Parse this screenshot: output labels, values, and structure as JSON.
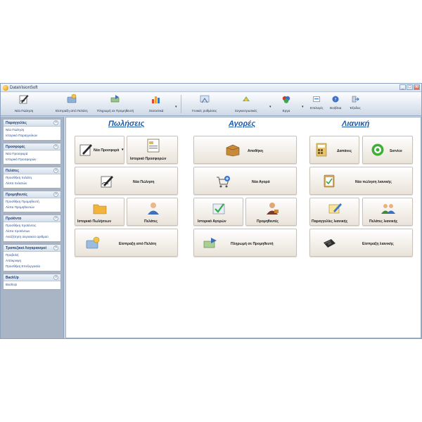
{
  "window": {
    "title": "DataVisionSoft",
    "buttons": [
      "_",
      "□",
      "x"
    ]
  },
  "toolbar": {
    "items": [
      {
        "label": "Νέα Πώληση",
        "icon": "pen-sign-icon"
      },
      {
        "label": "Είσπραξη από Πελάτη",
        "icon": "payment-icon"
      },
      {
        "label": "Πληρωμή σε Προμηθευτή",
        "icon": "money-transfer-icon"
      },
      {
        "label": "Στατιστικά",
        "icon": "statistics-icon"
      },
      {
        "label": "Γενικές ρυθμίσεις",
        "icon": "settings-icon"
      },
      {
        "label": "Συγκεντρωτικές",
        "icon": "summary-icon"
      },
      {
        "label": "Εργα",
        "icon": "projects-icon"
      },
      {
        "label": "Επιλογές",
        "icon": "options-icon"
      },
      {
        "label": "Βοήθεια",
        "icon": "help-icon"
      },
      {
        "label": "Έξοδος",
        "icon": "exit-icon"
      }
    ],
    "dropdown_glyph": "▾"
  },
  "sidebar": {
    "groups": [
      {
        "title": "Παραγγελίες",
        "items": [
          "Νέα Πώληση",
          "Ιστορικό Παραγγελιών"
        ]
      },
      {
        "title": "Προσφορές",
        "items": [
          "Νέα Προσφορά",
          "Ιστορικό Προσφορών"
        ]
      },
      {
        "title": "Πελάτες",
        "items": [
          "Προσθήκη πελάτη",
          "Λίστα πελατών"
        ]
      },
      {
        "title": "Προμηθευτές",
        "items": [
          "Προσθήκη Προμηθευτή",
          "Λίστα Προμηθευτών"
        ]
      },
      {
        "title": "Προϊόντα",
        "items": [
          "Προσθήκη προϊόντος",
          "Λίστα προϊόντων",
          "Αναζήτηση σειριακού αριθμού"
        ]
      },
      {
        "title": "Τραπεζικοί Λογαριασμοί",
        "items": [
          "Προβολή",
          "Απόκρυψη",
          "Προσθήκη Επεξεργασία"
        ]
      },
      {
        "title": "BackUp",
        "items": [
          "BackUp"
        ]
      }
    ],
    "chevron": "»"
  },
  "sections": {
    "sales": {
      "title": "Πωλήσεις",
      "new_offer": "Νέα Προσφορά",
      "offer_history": "Ιστορικό Προσφορών",
      "new_sale": "Νέα Πώληση",
      "sales_history": "Ιστορικό Πωλήσεων",
      "customers": "Πελάτες",
      "customer_collection": "Είσπραξη από Πελάτη"
    },
    "purchases": {
      "title": "Αγορές",
      "warehouse": "Αποθήκη",
      "new_purchase": "Νέα Αγορά",
      "purchase_history": "Ιστορικό Αγορών",
      "suppliers": "Προμηθευτές",
      "supplier_payment": "Πληρωμή σε Προμηθευτή"
    },
    "retail": {
      "title": "Λιανική",
      "expenses": "Δαπάνες",
      "service": "Service",
      "new_retail_sale": "Νέα πώληση λιανικής",
      "retail_orders": "Παραγγελίες λιανικής",
      "retail_customers": "Πελάτες λιανικής",
      "retail_collection": "Είσπραξη λιανικής"
    }
  }
}
